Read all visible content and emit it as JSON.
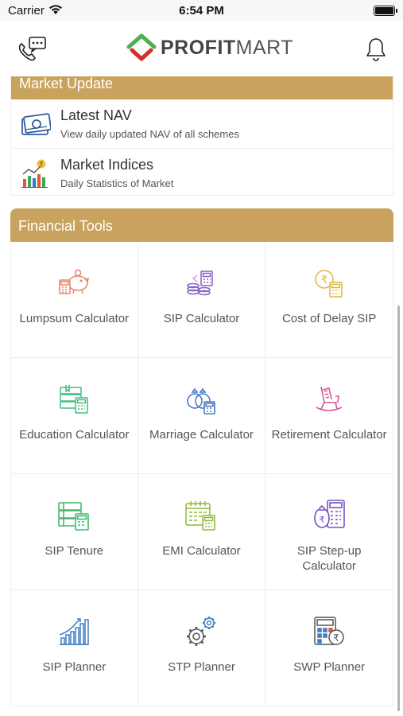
{
  "status_bar": {
    "carrier": "Carrier",
    "time": "6:54 PM"
  },
  "header": {
    "brand_bold": "PROFIT",
    "brand_light": "MART"
  },
  "market_update": {
    "title": "Market Update",
    "items": [
      {
        "title": "Latest NAV",
        "subtitle": "View daily updated NAV of all schemes",
        "icon": "money-icon"
      },
      {
        "title": "Market Indices",
        "subtitle": "Daily Statistics of Market",
        "icon": "market-chart-icon"
      }
    ]
  },
  "financial_tools": {
    "title": "Financial Tools",
    "items": [
      {
        "label": "Lumpsum Calculator",
        "icon": "piggy-bank-calculator-icon",
        "color": "#e8826a"
      },
      {
        "label": "SIP Calculator",
        "icon": "coin-stack-calculator-icon",
        "color": "#8a5fc9"
      },
      {
        "label": "Cost of Delay SIP",
        "icon": "rupee-clock-calculator-icon",
        "color": "#e0b63a"
      },
      {
        "label": "Education Calculator",
        "icon": "book-calculator-icon",
        "color": "#3fbf7f"
      },
      {
        "label": "Marriage Calculator",
        "icon": "rings-calculator-icon",
        "color": "#4a7ac8"
      },
      {
        "label": "Retirement Calculator",
        "icon": "rocking-chair-icon",
        "color": "#d9569e"
      },
      {
        "label": "SIP Tenure",
        "icon": "books-calculator-icon",
        "color": "#43b86a"
      },
      {
        "label": "EMI Calculator",
        "icon": "calendar-calculator-icon",
        "color": "#8fb83a"
      },
      {
        "label": "SIP Step-up Calculator",
        "icon": "money-bag-calculator-icon",
        "color": "#7a4fc4"
      },
      {
        "label": "SIP Planner",
        "icon": "growth-bars-icon",
        "color": "#3e7fc1"
      },
      {
        "label": "STP Planner",
        "icon": "gears-icon",
        "color": "#5a5a5a"
      },
      {
        "label": "SWP Planner",
        "icon": "rupee-calculator-icon",
        "color": "#3e7fc1"
      }
    ]
  }
}
